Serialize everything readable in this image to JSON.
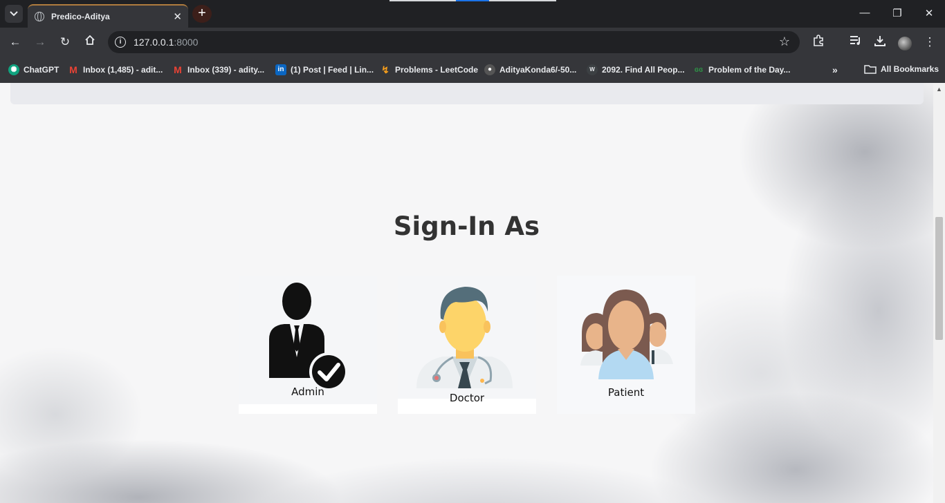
{
  "browser": {
    "tab_title": "Predico-Aditya",
    "url_host": "127.0.0.1",
    "url_port": ":8000",
    "bookmarks": [
      {
        "label": "ChatGPT",
        "icon": "chatgpt-icon"
      },
      {
        "label": "Inbox (1,485) - adit...",
        "icon": "gmail-icon"
      },
      {
        "label": "Inbox (339) - adity...",
        "icon": "gmail-icon"
      },
      {
        "label": "(1) Post | Feed | Lin...",
        "icon": "linkedin-icon"
      },
      {
        "label": "Problems - LeetCode",
        "icon": "leetcode-icon"
      },
      {
        "label": "AdityaKonda6/-50...",
        "icon": "github-icon"
      },
      {
        "label": "2092. Find All Peop...",
        "icon": "w-icon"
      },
      {
        "label": "Problem of the Day...",
        "icon": "gfg-icon"
      }
    ],
    "more_bookmarks": "»",
    "all_bookmarks": "All Bookmarks"
  },
  "page": {
    "heading": "Sign-In As",
    "roles": [
      {
        "label": "Admin",
        "icon": "admin-icon"
      },
      {
        "label": "Doctor",
        "icon": "doctor-icon"
      },
      {
        "label": "Patient",
        "icon": "patient-icon"
      }
    ]
  }
}
